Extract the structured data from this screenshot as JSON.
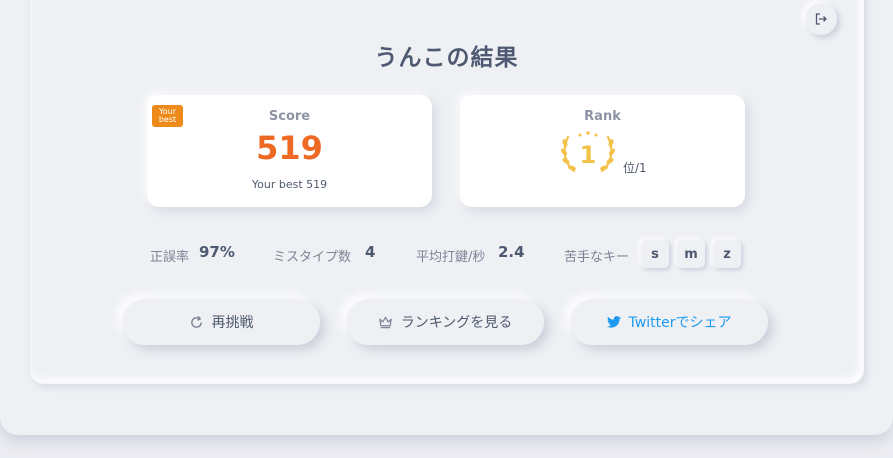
{
  "result": {
    "title": "うんこの結果"
  },
  "score": {
    "label": "Score",
    "value": "519",
    "best_text": "Your best 519",
    "badge_line1": "Your",
    "badge_line2": "best"
  },
  "rank": {
    "label": "Rank",
    "position": "1",
    "suffix": "位/1"
  },
  "stats": {
    "accuracy_label": "正誤率",
    "accuracy_value": "97%",
    "typo_label": "ミスタイプ数",
    "typo_value": "4",
    "speed_label": "平均打鍵/秒",
    "speed_value": "2.4",
    "weak_keys_label": "苦手なキー",
    "weak_keys": [
      "s",
      "m",
      "z"
    ]
  },
  "buttons": {
    "retry": "再挑戦",
    "ranking": "ランキングを見る",
    "share": "Twitterでシェア"
  },
  "colors": {
    "accent": "#ee6a24",
    "gold": "#f2c24a",
    "twitter": "#1d9bf0"
  },
  "icons": {
    "logout": "logout-icon",
    "retry": "refresh-icon",
    "ranking": "crown-icon",
    "share": "twitter-icon"
  }
}
